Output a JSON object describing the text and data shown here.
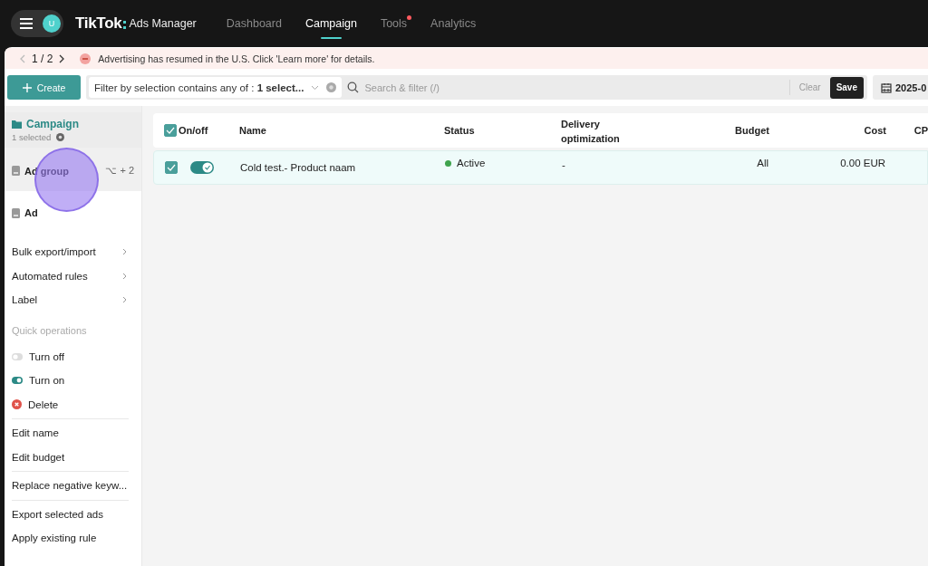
{
  "header": {
    "avatar": "U",
    "logo": "TikTok",
    "product": "Ads Manager",
    "nav": [
      {
        "label": "Dashboard",
        "selected": false,
        "badge": false
      },
      {
        "label": "Campaign",
        "selected": true,
        "badge": false
      },
      {
        "label": "Tools",
        "selected": false,
        "badge": true
      },
      {
        "label": "Analytics",
        "selected": false,
        "badge": false
      }
    ]
  },
  "banner": {
    "pager": "1 / 2",
    "message": "Advertising has resumed in the U.S. Click 'Learn more' for details."
  },
  "toolbar": {
    "create": "Create",
    "filter": "Filter by selection contains any of : **1 select...**",
    "search_placeholder": "Search & filter (/)",
    "clear": "Clear",
    "save": "Save",
    "date": "2025-0"
  },
  "levels": [
    {
      "label": "Campaign",
      "selected": true,
      "sub": "1 selected"
    },
    {
      "label": "Ad group",
      "selected": false,
      "shortcut": "⌥ + 2"
    },
    {
      "label": "Ad",
      "selected": false
    }
  ],
  "menu": [
    {
      "kind": "submenu",
      "label": "Bulk export/import",
      "separated": false
    },
    {
      "kind": "submenu",
      "label": "Automated rules",
      "separated": false
    },
    {
      "kind": "submenu",
      "label": "Label",
      "separated": false
    },
    {
      "kind": "heading",
      "label": "Quick operations",
      "separated": false
    },
    {
      "kind": "switch-off",
      "label": "Turn off",
      "separated": false
    },
    {
      "kind": "switch-on",
      "label": "Turn on",
      "separated": false
    },
    {
      "kind": "delete",
      "label": "Delete",
      "separated": false
    },
    {
      "kind": "action",
      "label": "Edit name",
      "separated": true
    },
    {
      "kind": "action",
      "label": "Edit budget",
      "separated": false
    },
    {
      "kind": "action",
      "label": "Replace negative keyw...",
      "separated": true
    },
    {
      "kind": "action",
      "label": "Export selected ads",
      "separated": true
    },
    {
      "kind": "action",
      "label": "Apply existing rule",
      "separated": false
    }
  ],
  "table": {
    "all_checked": true,
    "columns": [
      "On/off",
      "Name",
      "Status",
      "Delivery optimization",
      "Budget",
      "Cost",
      "CP"
    ],
    "rows": [
      {
        "checked": true,
        "on": true,
        "name": "Cold test.- Product naam",
        "status": "Active",
        "color": "#3fa34d",
        "delivery": "-",
        "budget": "All",
        "cost": "0.00 EUR"
      }
    ]
  }
}
